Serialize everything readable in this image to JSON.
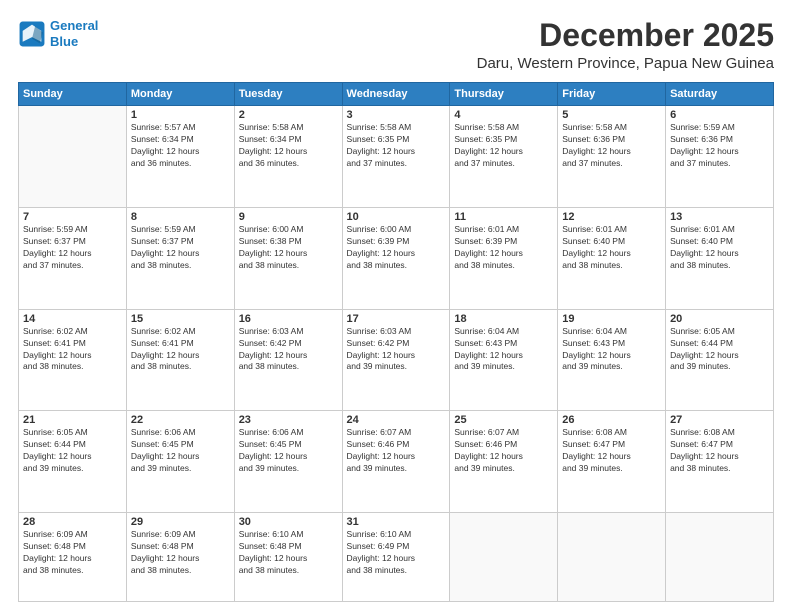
{
  "logo": {
    "line1": "General",
    "line2": "Blue"
  },
  "title": "December 2025",
  "subtitle": "Daru, Western Province, Papua New Guinea",
  "weekdays": [
    "Sunday",
    "Monday",
    "Tuesday",
    "Wednesday",
    "Thursday",
    "Friday",
    "Saturday"
  ],
  "weeks": [
    [
      {
        "day": "",
        "info": ""
      },
      {
        "day": "1",
        "info": "Sunrise: 5:57 AM\nSunset: 6:34 PM\nDaylight: 12 hours\nand 36 minutes."
      },
      {
        "day": "2",
        "info": "Sunrise: 5:58 AM\nSunset: 6:34 PM\nDaylight: 12 hours\nand 36 minutes."
      },
      {
        "day": "3",
        "info": "Sunrise: 5:58 AM\nSunset: 6:35 PM\nDaylight: 12 hours\nand 37 minutes."
      },
      {
        "day": "4",
        "info": "Sunrise: 5:58 AM\nSunset: 6:35 PM\nDaylight: 12 hours\nand 37 minutes."
      },
      {
        "day": "5",
        "info": "Sunrise: 5:58 AM\nSunset: 6:36 PM\nDaylight: 12 hours\nand 37 minutes."
      },
      {
        "day": "6",
        "info": "Sunrise: 5:59 AM\nSunset: 6:36 PM\nDaylight: 12 hours\nand 37 minutes."
      }
    ],
    [
      {
        "day": "7",
        "info": "Sunrise: 5:59 AM\nSunset: 6:37 PM\nDaylight: 12 hours\nand 37 minutes."
      },
      {
        "day": "8",
        "info": "Sunrise: 5:59 AM\nSunset: 6:37 PM\nDaylight: 12 hours\nand 38 minutes."
      },
      {
        "day": "9",
        "info": "Sunrise: 6:00 AM\nSunset: 6:38 PM\nDaylight: 12 hours\nand 38 minutes."
      },
      {
        "day": "10",
        "info": "Sunrise: 6:00 AM\nSunset: 6:39 PM\nDaylight: 12 hours\nand 38 minutes."
      },
      {
        "day": "11",
        "info": "Sunrise: 6:01 AM\nSunset: 6:39 PM\nDaylight: 12 hours\nand 38 minutes."
      },
      {
        "day": "12",
        "info": "Sunrise: 6:01 AM\nSunset: 6:40 PM\nDaylight: 12 hours\nand 38 minutes."
      },
      {
        "day": "13",
        "info": "Sunrise: 6:01 AM\nSunset: 6:40 PM\nDaylight: 12 hours\nand 38 minutes."
      }
    ],
    [
      {
        "day": "14",
        "info": "Sunrise: 6:02 AM\nSunset: 6:41 PM\nDaylight: 12 hours\nand 38 minutes."
      },
      {
        "day": "15",
        "info": "Sunrise: 6:02 AM\nSunset: 6:41 PM\nDaylight: 12 hours\nand 38 minutes."
      },
      {
        "day": "16",
        "info": "Sunrise: 6:03 AM\nSunset: 6:42 PM\nDaylight: 12 hours\nand 38 minutes."
      },
      {
        "day": "17",
        "info": "Sunrise: 6:03 AM\nSunset: 6:42 PM\nDaylight: 12 hours\nand 39 minutes."
      },
      {
        "day": "18",
        "info": "Sunrise: 6:04 AM\nSunset: 6:43 PM\nDaylight: 12 hours\nand 39 minutes."
      },
      {
        "day": "19",
        "info": "Sunrise: 6:04 AM\nSunset: 6:43 PM\nDaylight: 12 hours\nand 39 minutes."
      },
      {
        "day": "20",
        "info": "Sunrise: 6:05 AM\nSunset: 6:44 PM\nDaylight: 12 hours\nand 39 minutes."
      }
    ],
    [
      {
        "day": "21",
        "info": "Sunrise: 6:05 AM\nSunset: 6:44 PM\nDaylight: 12 hours\nand 39 minutes."
      },
      {
        "day": "22",
        "info": "Sunrise: 6:06 AM\nSunset: 6:45 PM\nDaylight: 12 hours\nand 39 minutes."
      },
      {
        "day": "23",
        "info": "Sunrise: 6:06 AM\nSunset: 6:45 PM\nDaylight: 12 hours\nand 39 minutes."
      },
      {
        "day": "24",
        "info": "Sunrise: 6:07 AM\nSunset: 6:46 PM\nDaylight: 12 hours\nand 39 minutes."
      },
      {
        "day": "25",
        "info": "Sunrise: 6:07 AM\nSunset: 6:46 PM\nDaylight: 12 hours\nand 39 minutes."
      },
      {
        "day": "26",
        "info": "Sunrise: 6:08 AM\nSunset: 6:47 PM\nDaylight: 12 hours\nand 39 minutes."
      },
      {
        "day": "27",
        "info": "Sunrise: 6:08 AM\nSunset: 6:47 PM\nDaylight: 12 hours\nand 38 minutes."
      }
    ],
    [
      {
        "day": "28",
        "info": "Sunrise: 6:09 AM\nSunset: 6:48 PM\nDaylight: 12 hours\nand 38 minutes."
      },
      {
        "day": "29",
        "info": "Sunrise: 6:09 AM\nSunset: 6:48 PM\nDaylight: 12 hours\nand 38 minutes."
      },
      {
        "day": "30",
        "info": "Sunrise: 6:10 AM\nSunset: 6:48 PM\nDaylight: 12 hours\nand 38 minutes."
      },
      {
        "day": "31",
        "info": "Sunrise: 6:10 AM\nSunset: 6:49 PM\nDaylight: 12 hours\nand 38 minutes."
      },
      {
        "day": "",
        "info": ""
      },
      {
        "day": "",
        "info": ""
      },
      {
        "day": "",
        "info": ""
      }
    ]
  ]
}
